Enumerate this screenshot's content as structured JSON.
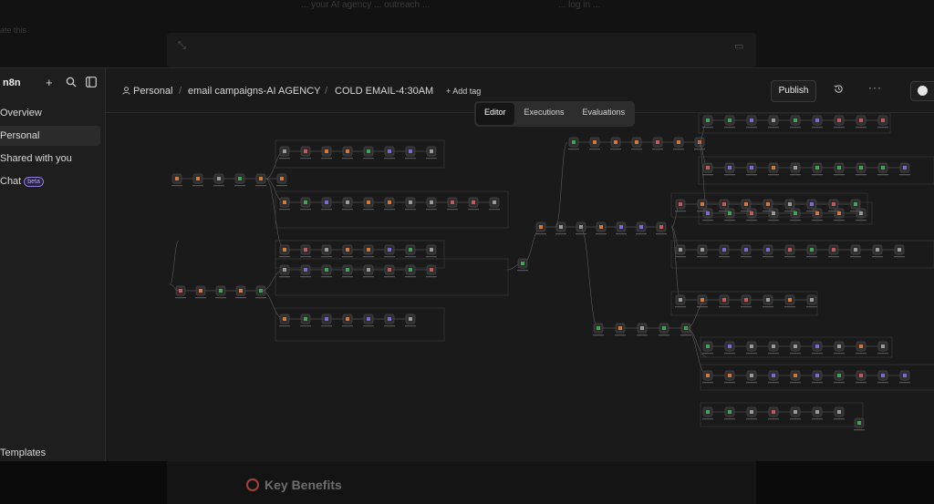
{
  "background": {
    "top_left_faint": "ate this",
    "top_faint_text": "... your AI agency ... outreach ...",
    "top_faint_right": "... log in ..."
  },
  "sidebar": {
    "brand": "n8n",
    "items": [
      {
        "label": "Overview"
      },
      {
        "label": "Personal",
        "active": true
      },
      {
        "label": "Shared with you"
      },
      {
        "label": "Chat",
        "badge": "beta"
      }
    ],
    "footer_item": "Templates"
  },
  "header": {
    "breadcrumb": [
      "Personal",
      "email campaigns-AI AGENCY",
      "COLD EMAIL-4:30AM"
    ],
    "add_tag": "+ Add tag",
    "publish": "Publish"
  },
  "tabs": [
    {
      "label": "Editor",
      "active": true
    },
    {
      "label": "Executions"
    },
    {
      "label": "Evaluations"
    }
  ],
  "footer": {
    "key_benefits": "Key Benefits"
  },
  "colors": {
    "accent": "#8f7ad8",
    "node_green": "#3fa654",
    "node_orange": "#d6783e",
    "node_purple": "#7b6ad8"
  }
}
